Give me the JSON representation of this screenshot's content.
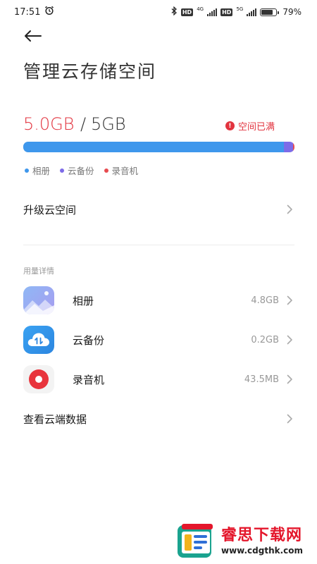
{
  "status_bar": {
    "time": "17:51",
    "net1": "4G",
    "net2": "5G",
    "hd": "HD",
    "battery_text": "79%",
    "battery_level": 0.79
  },
  "header": {
    "back_icon": "arrow-left-icon",
    "title": "管理云存储空间"
  },
  "usage": {
    "used": "5.0GB",
    "separator": "/",
    "total": "5GB",
    "full_status": "空间已满",
    "segments": {
      "album": 0.96,
      "backup": 0.035,
      "recorder": 0.005
    },
    "legend": [
      {
        "label": "相册",
        "color": "#3e97ec"
      },
      {
        "label": "云备份",
        "color": "#7d6be8"
      },
      {
        "label": "录音机",
        "color": "#e74b50"
      }
    ]
  },
  "upgrade": {
    "label": "升级云空间"
  },
  "details": {
    "section_label": "用量详情",
    "items": [
      {
        "name": "相册",
        "size": "4.8GB",
        "icon": "gallery-icon"
      },
      {
        "name": "云备份",
        "size": "0.2GB",
        "icon": "cloud-backup-icon"
      },
      {
        "name": "录音机",
        "size": "43.5MB",
        "icon": "recorder-icon"
      }
    ]
  },
  "cloud_data": {
    "label": "查看云端数据"
  },
  "watermark": {
    "title": "睿思下载网",
    "url": "www.cdgthk.com"
  },
  "colors": {
    "accent_red": "#e2343f",
    "bar_blue": "#3e97ec",
    "bar_purple": "#7d6be8",
    "bar_red": "#e74b50"
  }
}
